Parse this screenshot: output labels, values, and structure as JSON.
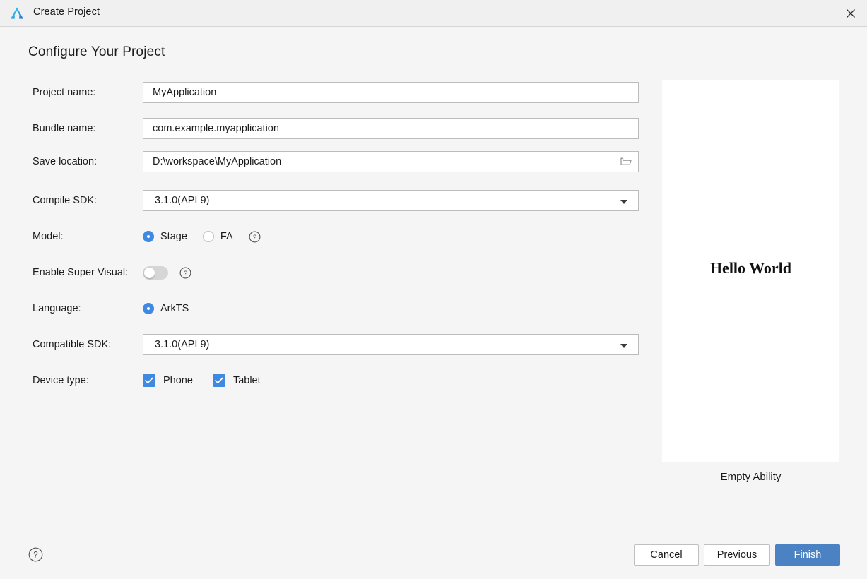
{
  "window": {
    "title": "Create Project",
    "logo_icon": "deveco-studio-logo-icon",
    "close_icon": "close-icon"
  },
  "page": {
    "heading": "Configure Your Project"
  },
  "form": {
    "project_name": {
      "label": "Project name:",
      "value": "MyApplication",
      "placeholder": "MyApplication"
    },
    "bundle_name": {
      "label": "Bundle name:",
      "value": "com.example.myapplication",
      "placeholder": "com.example.myapplication"
    },
    "save_location": {
      "label": "Save location:",
      "value": "D:\\workspace\\MyApplication",
      "placeholder": "D:\\workspace\\MyApplication",
      "browse_icon": "folder-icon"
    },
    "compile_sdk": {
      "label": "Compile SDK:",
      "value": "3.1.0(API 9)",
      "options": [
        "3.1.0(API 9)"
      ],
      "caret_icon": "chevron-down-icon"
    },
    "model": {
      "label": "Model:",
      "options": [
        "Stage",
        "FA"
      ],
      "selected": "Stage",
      "help_icon": "help-circle-icon"
    },
    "enable_super_visual": {
      "label": "Enable Super Visual:",
      "checked": false,
      "help_icon": "help-circle-icon"
    },
    "language": {
      "label": "Language:",
      "options": [
        "ArkTS"
      ],
      "selected": "ArkTS"
    },
    "compatible_sdk": {
      "label": "Compatible SDK:",
      "value": "3.1.0(API 9)",
      "options": [
        "3.1.0(API 9)"
      ],
      "caret_icon": "chevron-down-icon"
    },
    "device_type": {
      "label": "Device type:",
      "items": [
        {
          "label": "Phone",
          "checked": true
        },
        {
          "label": "Tablet",
          "checked": true
        }
      ]
    }
  },
  "preview": {
    "hello_text": "Hello World",
    "caption": "Empty Ability"
  },
  "footer": {
    "help_icon": "help-circle-icon",
    "cancel_label": "Cancel",
    "previous_label": "Previous",
    "finish_label": "Finish"
  },
  "colors": {
    "accent": "#3f8ae0",
    "primary_button": "#4a82c3",
    "background": "#f5f5f5",
    "titlebar": "#f0f0f0",
    "field_border": "#bcbcbc"
  }
}
